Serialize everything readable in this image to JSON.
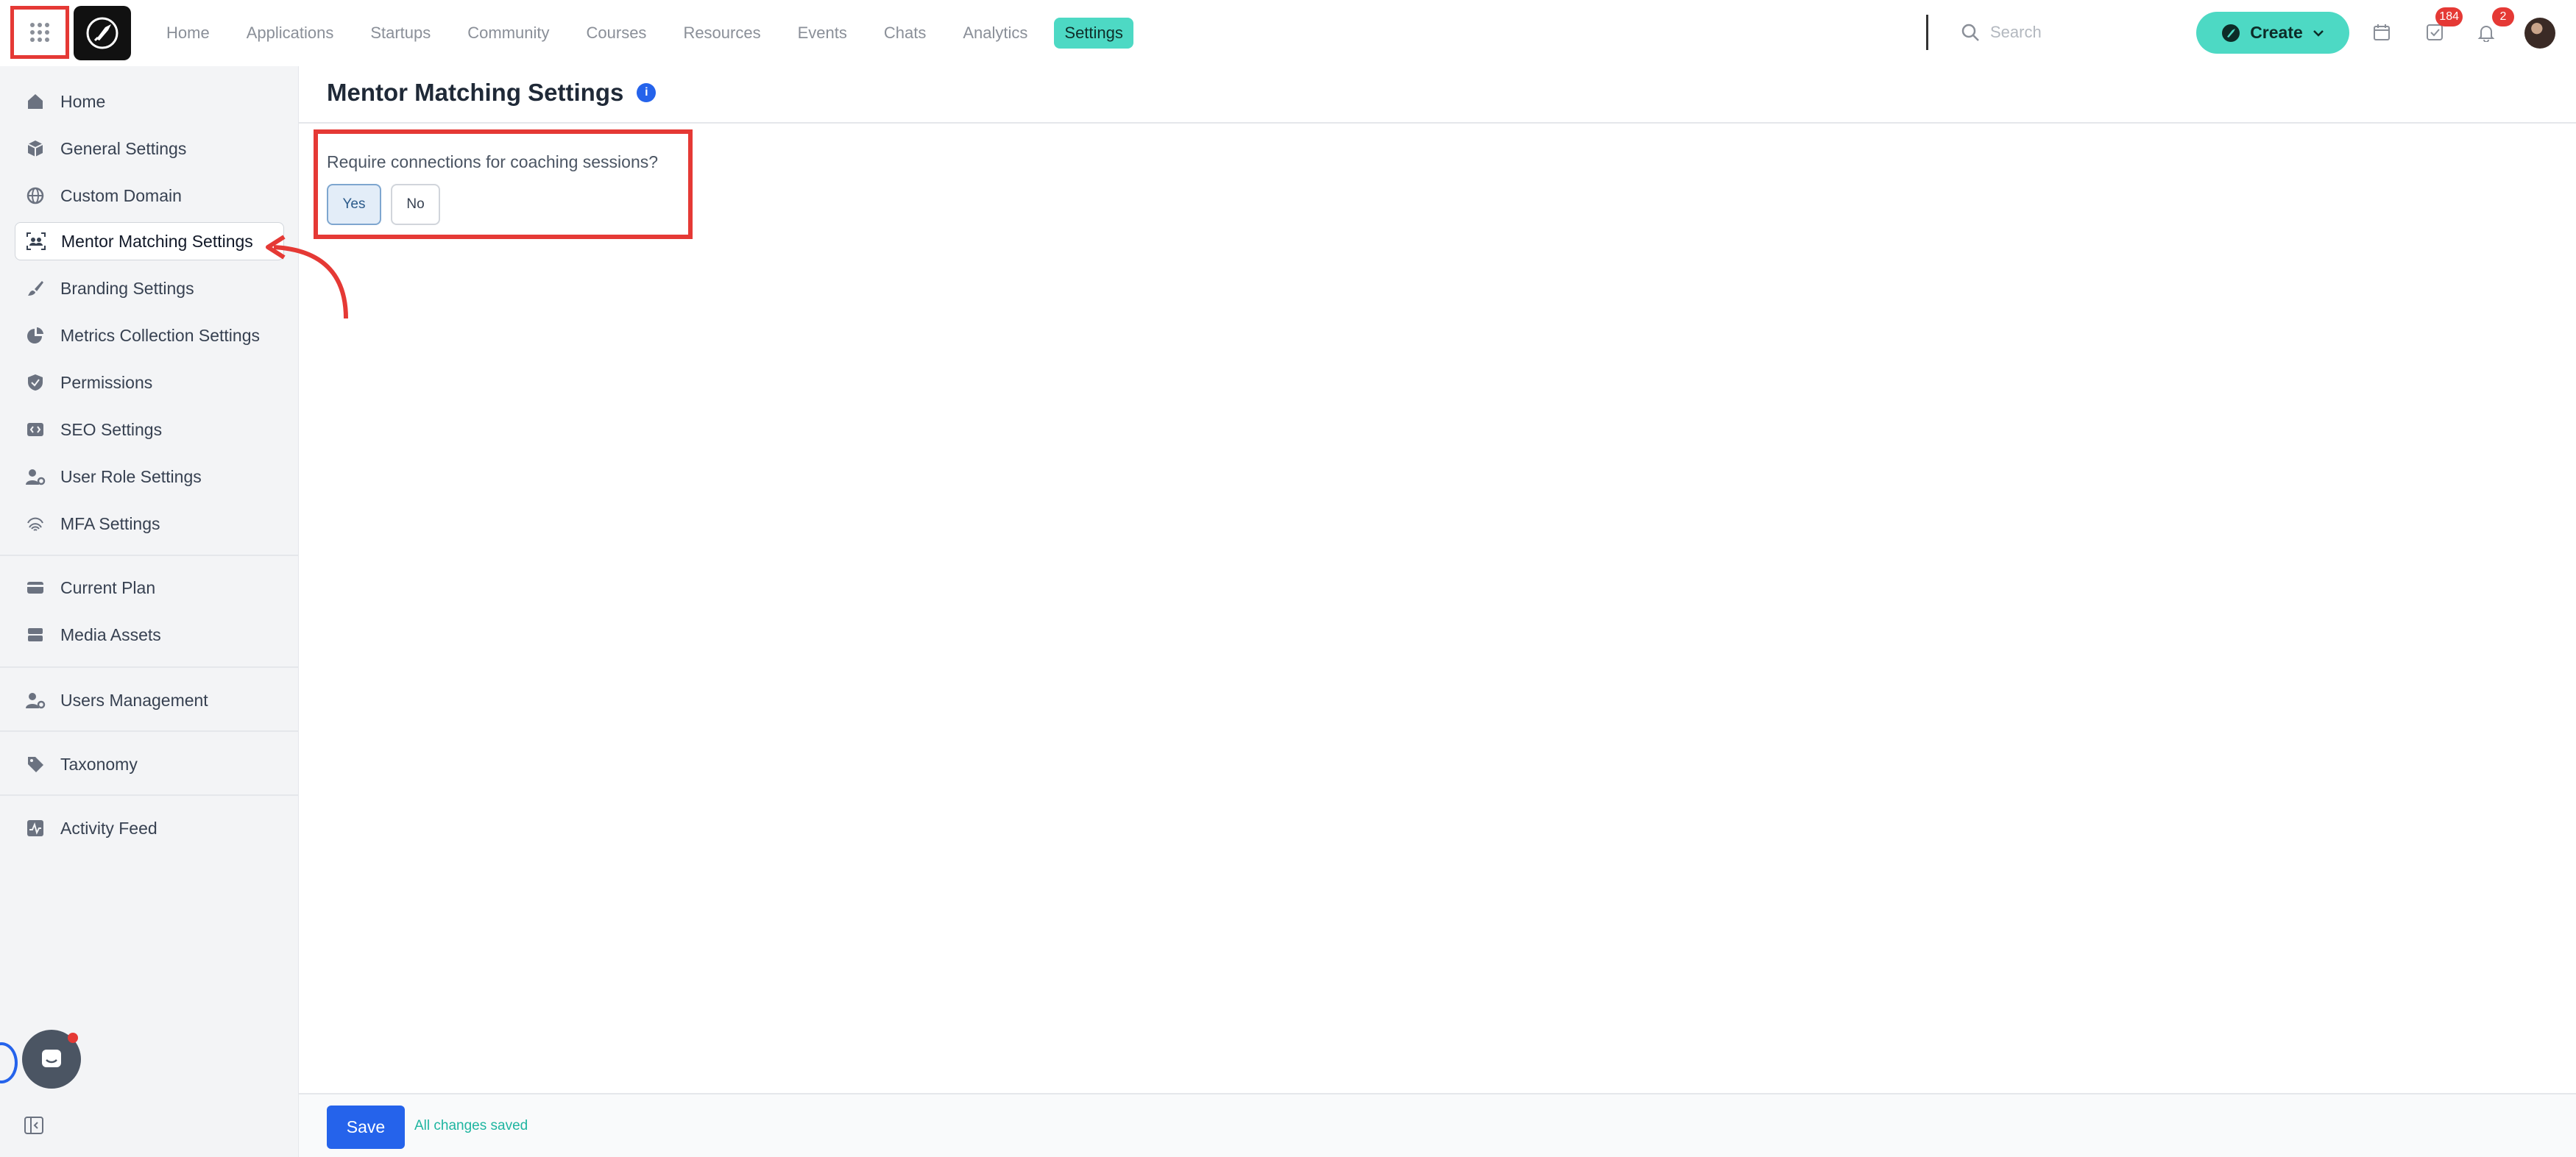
{
  "app": {
    "accent_color": "#4dd9c4",
    "annotation_color": "#e53935"
  },
  "topbar": {
    "nav": [
      {
        "label": "Home",
        "active": false
      },
      {
        "label": "Applications",
        "active": false
      },
      {
        "label": "Startups",
        "active": false
      },
      {
        "label": "Community",
        "active": false
      },
      {
        "label": "Courses",
        "active": false
      },
      {
        "label": "Resources",
        "active": false
      },
      {
        "label": "Events",
        "active": false
      },
      {
        "label": "Chats",
        "active": false
      },
      {
        "label": "Analytics",
        "active": false
      },
      {
        "label": "Settings",
        "active": true
      }
    ],
    "search_placeholder": "Search",
    "create_label": "Create",
    "tasks_badge": "184",
    "notifications_badge": "2"
  },
  "sidebar": {
    "group1": [
      {
        "label": "Home",
        "icon": "home-icon"
      },
      {
        "label": "General Settings",
        "icon": "cube-icon"
      },
      {
        "label": "Custom Domain",
        "icon": "globe-icon"
      },
      {
        "label": "Mentor Matching Settings",
        "icon": "people-frame-icon",
        "active": true
      },
      {
        "label": "Branding Settings",
        "icon": "brush-icon"
      },
      {
        "label": "Metrics Collection Settings",
        "icon": "pie-chart-icon"
      },
      {
        "label": "Permissions",
        "icon": "shield-icon"
      },
      {
        "label": "SEO Settings",
        "icon": "code-icon"
      },
      {
        "label": "User Role Settings",
        "icon": "user-gear-icon"
      },
      {
        "label": "MFA Settings",
        "icon": "fingerprint-icon"
      }
    ],
    "group2": [
      {
        "label": "Current Plan",
        "icon": "credit-card-icon"
      },
      {
        "label": "Media Assets",
        "icon": "media-icon"
      }
    ],
    "group3": [
      {
        "label": "Users Management",
        "icon": "user-gear-icon"
      }
    ],
    "group4": [
      {
        "label": "Taxonomy",
        "icon": "tag-icon"
      }
    ],
    "group5": [
      {
        "label": "Activity Feed",
        "icon": "activity-icon"
      }
    ]
  },
  "main": {
    "title": "Mentor Matching Settings",
    "question": "Require connections for coaching sessions?",
    "options": {
      "yes": "Yes",
      "no": "No",
      "selected": "Yes"
    }
  },
  "footer": {
    "save_label": "Save",
    "status": "All changes saved"
  }
}
